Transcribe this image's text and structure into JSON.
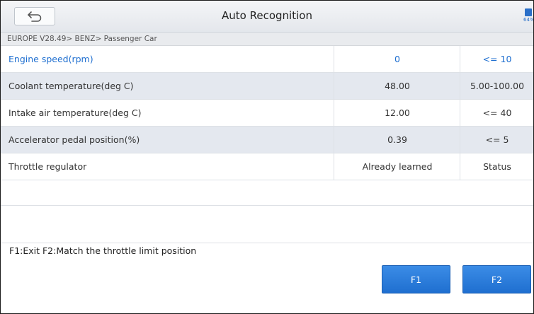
{
  "header": {
    "title": "Auto Recognition",
    "back_icon": "back-arrow-icon",
    "battery_icon": "battery-icon",
    "battery_percent": "64%"
  },
  "breadcrumb": "EUROPE V28.49> BENZ> Passenger Car",
  "table": {
    "rows": [
      {
        "name": "Engine speed(rpm)",
        "value": "0",
        "range": "<= 10"
      },
      {
        "name": "Coolant temperature(deg C)",
        "value": "48.00",
        "range": "5.00-100.00"
      },
      {
        "name": "Intake air temperature(deg C)",
        "value": "12.00",
        "range": "<= 40"
      },
      {
        "name": "Accelerator pedal position(%)",
        "value": "0.39",
        "range": "<= 5"
      },
      {
        "name": "Throttle regulator",
        "value": "Already learned",
        "range": "Status"
      }
    ]
  },
  "help_text": "F1:Exit F2:Match the throttle limit position",
  "buttons": {
    "f1": "F1",
    "f2": "F2"
  },
  "colors": {
    "accent": "#1f6fd0",
    "selected_text": "#1f6fd0",
    "alt_row": "#e4e8ef"
  }
}
